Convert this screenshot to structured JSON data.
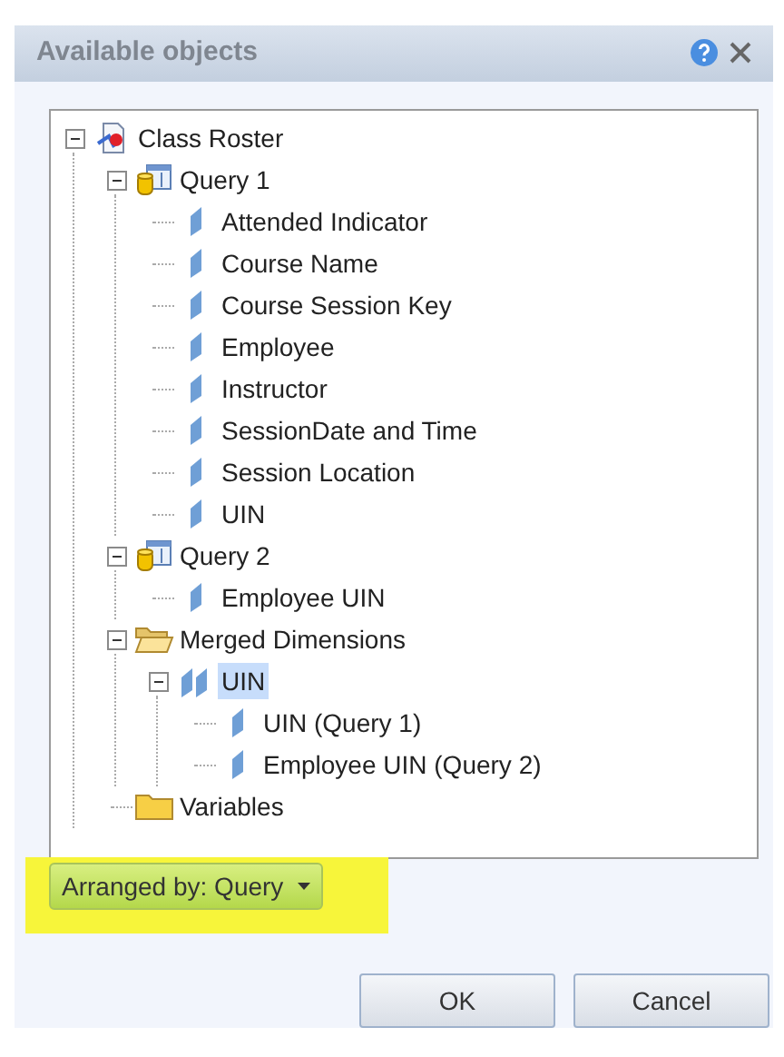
{
  "window": {
    "title": "Available objects"
  },
  "tree": [
    {
      "label": "Class Roster",
      "kind": "report",
      "expanded": true,
      "selected": false,
      "children": [
        {
          "label": "Query 1",
          "kind": "query",
          "expanded": true,
          "selected": false,
          "children": [
            {
              "label": "Attended Indicator",
              "kind": "dimension",
              "selected": false
            },
            {
              "label": "Course Name",
              "kind": "dimension",
              "selected": false
            },
            {
              "label": "Course Session Key",
              "kind": "dimension",
              "selected": false
            },
            {
              "label": "Employee",
              "kind": "dimension",
              "selected": false
            },
            {
              "label": "Instructor",
              "kind": "dimension",
              "selected": false
            },
            {
              "label": "SessionDate and Time",
              "kind": "dimension",
              "selected": false
            },
            {
              "label": "Session Location",
              "kind": "dimension",
              "selected": false
            },
            {
              "label": "UIN",
              "kind": "dimension",
              "selected": false
            }
          ]
        },
        {
          "label": "Query 2",
          "kind": "query",
          "expanded": true,
          "selected": false,
          "children": [
            {
              "label": "Employee UIN",
              "kind": "dimension",
              "selected": false
            }
          ]
        },
        {
          "label": "Merged Dimensions",
          "kind": "folder-open",
          "expanded": true,
          "selected": false,
          "children": [
            {
              "label": "UIN",
              "kind": "merged",
              "expanded": true,
              "selected": true,
              "children": [
                {
                  "label": "UIN (Query 1)",
                  "kind": "dimension",
                  "selected": false
                },
                {
                  "label": "Employee UIN (Query 2)",
                  "kind": "dimension",
                  "selected": false
                }
              ]
            }
          ]
        },
        {
          "label": "Variables",
          "kind": "folder",
          "selected": false
        }
      ]
    }
  ],
  "arrange_button": {
    "label": "Arranged by: Query"
  },
  "buttons": [
    "OK",
    "Cancel"
  ]
}
